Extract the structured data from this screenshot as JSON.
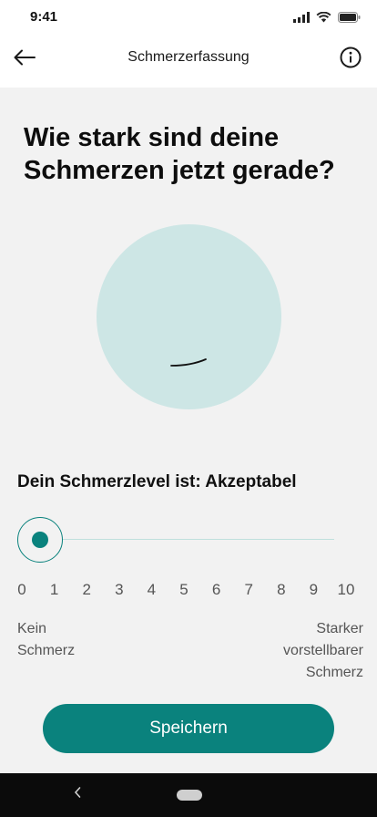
{
  "status_bar": {
    "time": "9:41",
    "icons": [
      "signal-icon",
      "wifi-icon",
      "battery-icon"
    ]
  },
  "header": {
    "title": "Schmerzerfassung",
    "back_icon": "arrow-left-icon",
    "info_icon": "info-icon"
  },
  "question": "Wie stark sind deine Schmerzen jetzt gerade?",
  "face": {
    "icon": "pain-face-icon",
    "color": "#cde6e5"
  },
  "level_text": "Dein Schmerzlevel ist: Akzeptabel",
  "slider": {
    "min": 0,
    "max": 10,
    "value": 0,
    "ticks": [
      "0",
      "1",
      "2",
      "3",
      "4",
      "5",
      "6",
      "7",
      "8",
      "9",
      "10"
    ],
    "min_label": "Kein\nSchmerz",
    "max_label": "Starker\nvorstellbarer\nSchmerz"
  },
  "save_label": "Speichern",
  "colors": {
    "accent": "#0a827d",
    "background": "#f2f2f2",
    "track": "#bfe0dd"
  },
  "nav_bar": {
    "back_icon": "chevron-left-icon",
    "home_icon": "home-pill-icon"
  }
}
